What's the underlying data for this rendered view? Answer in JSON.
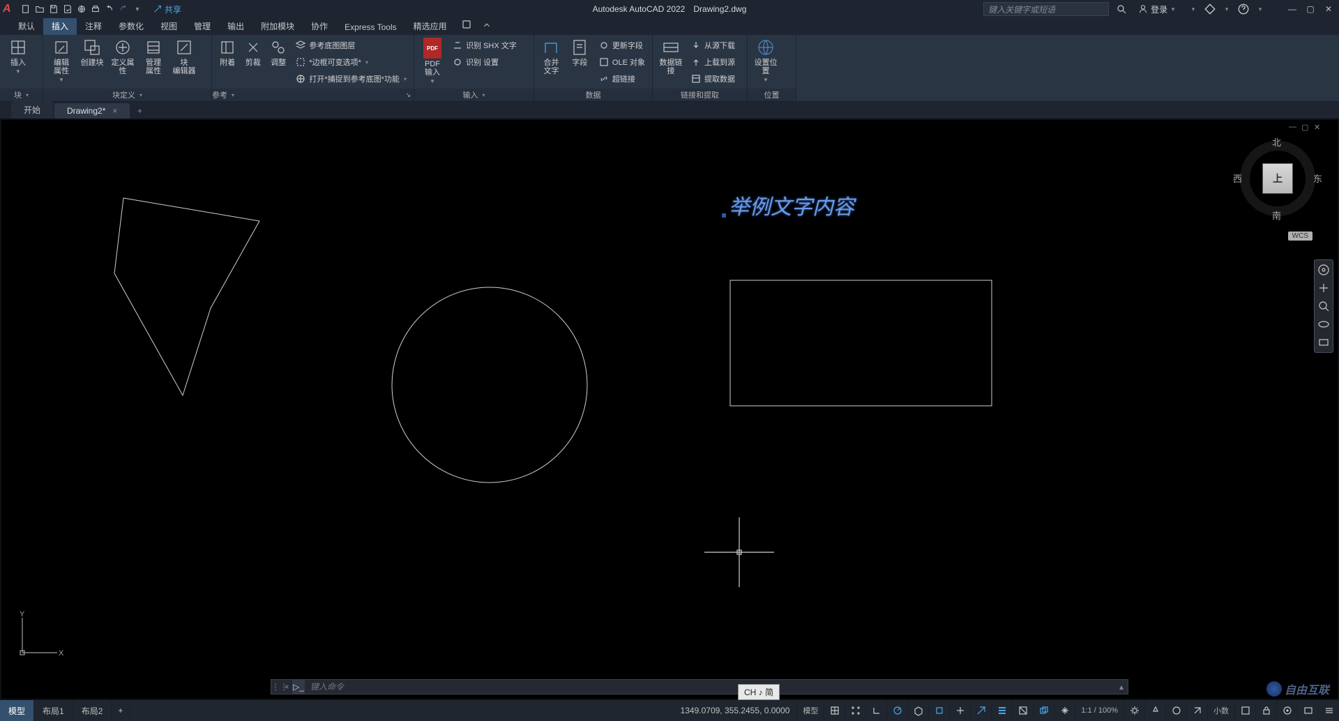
{
  "title": {
    "app": "Autodesk AutoCAD 2022",
    "file": "Drawing2.dwg"
  },
  "share": "共享",
  "search_placeholder": "键入关键字或短语",
  "login": "登录",
  "ribbon_tabs": [
    "默认",
    "插入",
    "注释",
    "参数化",
    "视图",
    "管理",
    "输出",
    "附加模块",
    "协作",
    "Express Tools",
    "精选应用"
  ],
  "ribbon": {
    "block": {
      "title": "块",
      "insert": "插入",
      "edit_attr": "编辑\n属性",
      "create": "创建块",
      "def_attr": "定义属性",
      "manage": "管理\n属性",
      "blk_editor": "块\n编辑器",
      "panel_title": "块定义"
    },
    "ref": {
      "panel_title": "参考",
      "attach": "附着",
      "clip": "剪裁",
      "adjust": "调整",
      "r1": "参考底图图层",
      "r2": "*边框可变选项*",
      "r3": "打开*捕捉到参考底图*功能"
    },
    "import": {
      "panel_title": "输入",
      "pdf": "PDF\n输入",
      "s1": "识别 SHX 文字",
      "s2": "识别 设置"
    },
    "text": {
      "merge": "合并\n文字",
      "field": "字段",
      "u1": "更新字段",
      "u2": "OLE 对象",
      "u3": "超链接",
      "panel_title": "数据"
    },
    "link": {
      "dl": "数据链接",
      "d1": "从源下载",
      "d2": "上载到源",
      "d3": "提取数据",
      "panel_title": "链接和提取"
    },
    "loc": {
      "set": "设置位置",
      "panel_title": "位置"
    }
  },
  "file_tabs": {
    "start": "开始",
    "active": "Drawing2*"
  },
  "viewcube": {
    "top": "上",
    "n": "北",
    "s": "南",
    "e": "东",
    "w": "西",
    "wcs": "WCS"
  },
  "canvas_text": "举例文字内容",
  "cmd_placeholder": "键入命令",
  "ime": "CH ♪ 简",
  "layout_tabs": [
    "模型",
    "布局1",
    "布局2"
  ],
  "status": {
    "coords": "1349.0709, 355.2455, 0.0000",
    "model": "模型",
    "scale": "1:1 / 100%",
    "dec": "小数"
  },
  "watermark": "自由互联"
}
